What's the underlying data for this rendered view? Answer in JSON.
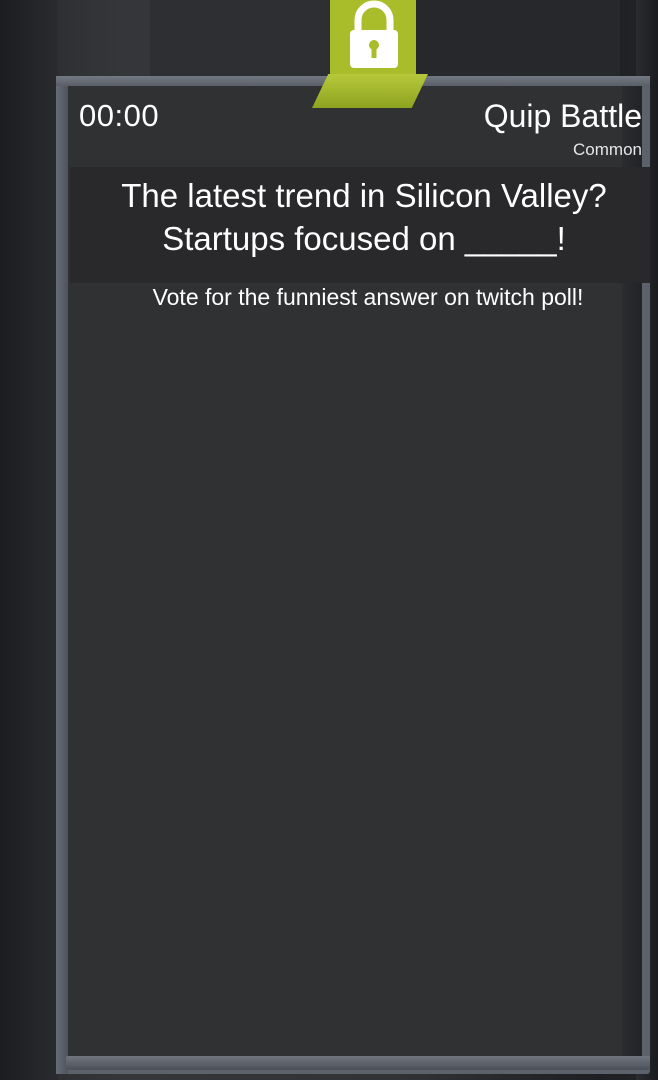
{
  "header": {
    "timer": "00:00",
    "mode_title": "Quip Battle",
    "mode_subtitle": "Common"
  },
  "prompt": {
    "text": "The latest trend in Silicon Valley?\nStartups focused on _____!"
  },
  "instruction": "Vote for the funniest answer on twitch poll!",
  "icons": {
    "lock": "padlock-icon"
  },
  "colors": {
    "accent": "#a9bd2a",
    "panel": "#29292b",
    "frame": "#5c626b",
    "text": "#ffffff"
  }
}
